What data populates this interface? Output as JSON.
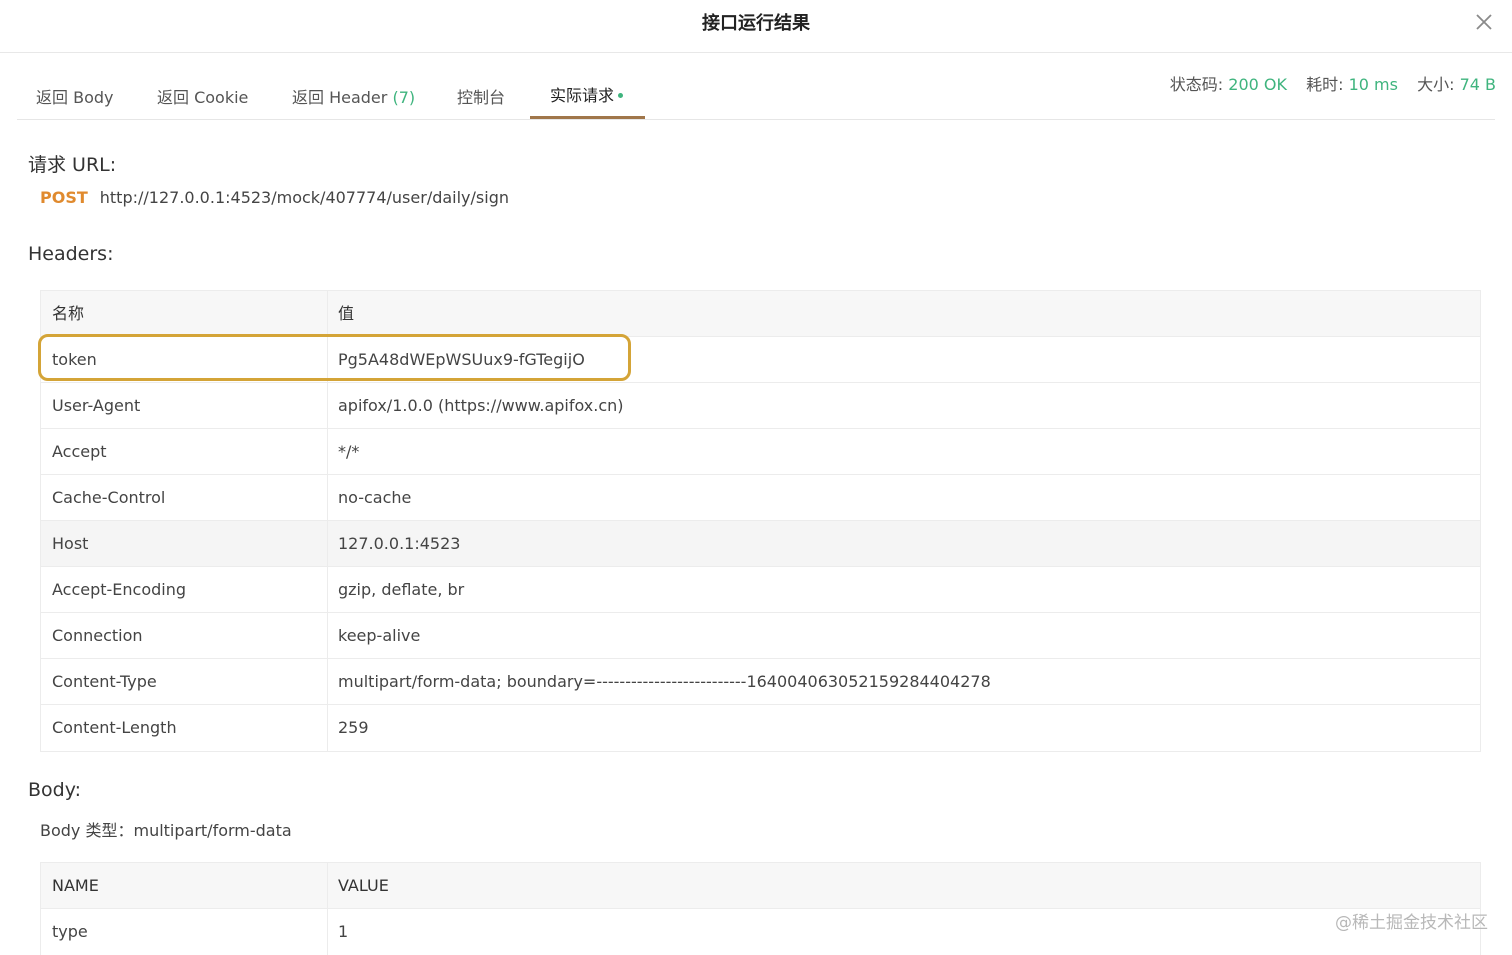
{
  "dialog": {
    "title": "接口运行结果"
  },
  "tabs": [
    {
      "label": "返回 Body"
    },
    {
      "label": "返回 Cookie"
    },
    {
      "label": "返回 Header",
      "count": "(7)"
    },
    {
      "label": "控制台"
    },
    {
      "label": "实际请求"
    }
  ],
  "status": {
    "code_label": "状态码:",
    "code_value": "200 OK",
    "time_label": "耗时:",
    "time_value": "10 ms",
    "size_label": "大小:",
    "size_value": "74 B"
  },
  "request": {
    "title": "请求 URL:",
    "method": "POST",
    "url": "http://127.0.0.1:4523/mock/407774/user/daily/sign"
  },
  "headers": {
    "title": "Headers:",
    "columns": [
      "名称",
      "值"
    ],
    "rows": [
      {
        "name": "token",
        "value": "Pg5A48dWEpWSUux9-fGTegijO"
      },
      {
        "name": "User-Agent",
        "value": "apifox/1.0.0 (https://www.apifox.cn)"
      },
      {
        "name": "Accept",
        "value": "*/*"
      },
      {
        "name": "Cache-Control",
        "value": "no-cache"
      },
      {
        "name": "Host",
        "value": "127.0.0.1:4523"
      },
      {
        "name": "Accept-Encoding",
        "value": "gzip, deflate, br"
      },
      {
        "name": "Connection",
        "value": "keep-alive"
      },
      {
        "name": "Content-Type",
        "value": "multipart/form-data; boundary=--------------------------164004063052159284404278"
      },
      {
        "name": "Content-Length",
        "value": "259"
      }
    ]
  },
  "body": {
    "title": "Body:",
    "type_label": "Body 类型：multipart/form-data",
    "columns": [
      "NAME",
      "VALUE"
    ],
    "rows": [
      {
        "name": "type",
        "value": "1"
      }
    ]
  },
  "watermark": "@稀土掘金技术社区",
  "colors": {
    "accent": "#3fb47e",
    "method": "#e08a2e",
    "tab_underline": "#a0764a",
    "highlight": "#d4a437"
  },
  "icons": {
    "close": "close-icon"
  }
}
